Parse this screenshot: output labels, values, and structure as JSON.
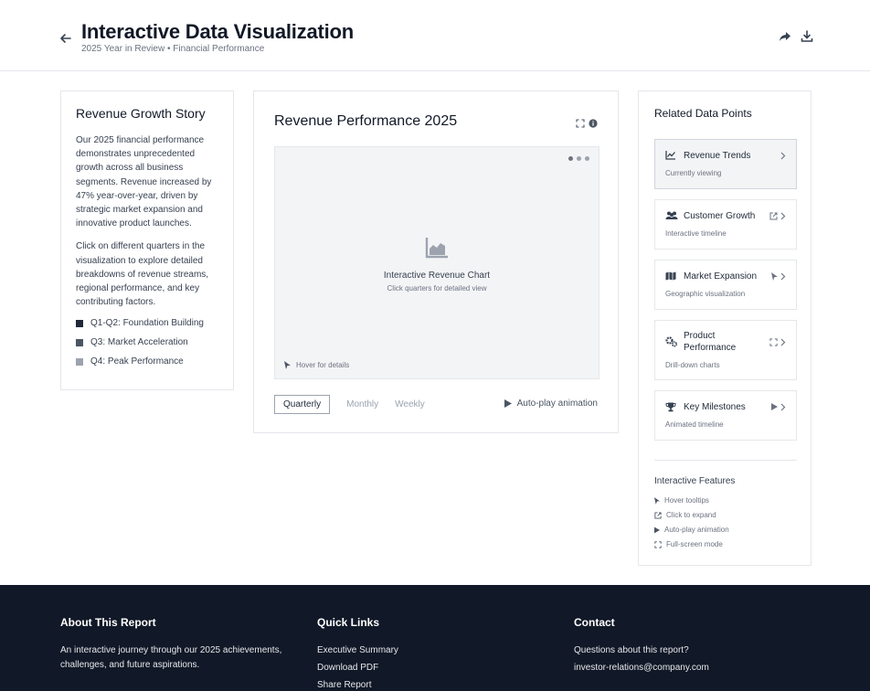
{
  "header": {
    "title": "Interactive Data Visualization",
    "subtitle": "2025 Year in Review • Financial Performance"
  },
  "story": {
    "heading": "Revenue Growth Story",
    "paragraph1": "Our 2025 financial performance demonstrates unprecedented growth across all business segments. Revenue increased by 47% year-over-year, driven by strategic market expansion and innovative product launches.",
    "paragraph2": "Click on different quarters in the visualization to explore detailed breakdowns of revenue streams, regional performance, and key contributing factors.",
    "legend": [
      {
        "label": "Q1-Q2: Foundation Building",
        "color": "#1f2937"
      },
      {
        "label": "Q3: Market Acceleration",
        "color": "#4b5563"
      },
      {
        "label": "Q4: Peak Performance",
        "color": "#9ca3af"
      }
    ]
  },
  "chart": {
    "heading": "Revenue Performance 2025",
    "placeholder_title": "Interactive Revenue Chart",
    "placeholder_sub": "Click quarters for detailed view",
    "hover_hint": "Hover for details",
    "tabs": [
      "Quarterly",
      "Monthly",
      "Weekly"
    ],
    "autoplay": "Auto-play animation"
  },
  "related": {
    "heading": "Related Data Points",
    "items": [
      {
        "label": "Revenue Trends",
        "sub": "Currently viewing"
      },
      {
        "label": "Customer Growth",
        "sub": "Interactive timeline"
      },
      {
        "label": "Market Expansion",
        "sub": "Geographic visualization"
      },
      {
        "label": "Product Performance",
        "sub": "Drill-down charts"
      },
      {
        "label": "Key Milestones",
        "sub": "Animated timeline"
      }
    ],
    "features_title": "Interactive Features",
    "features": [
      "Hover tooltips",
      "Click to expand",
      "Auto-play animation",
      "Full-screen mode"
    ]
  },
  "footer": {
    "about_title": "About This Report",
    "about_text": "An interactive journey through our 2025 achievements, challenges, and future aspirations.",
    "links_title": "Quick Links",
    "links": [
      "Executive Summary",
      "Download PDF",
      "Share Report"
    ],
    "contact_title": "Contact",
    "contact_q": "Questions about this report?",
    "contact_email": "investor-relations@company.com"
  }
}
